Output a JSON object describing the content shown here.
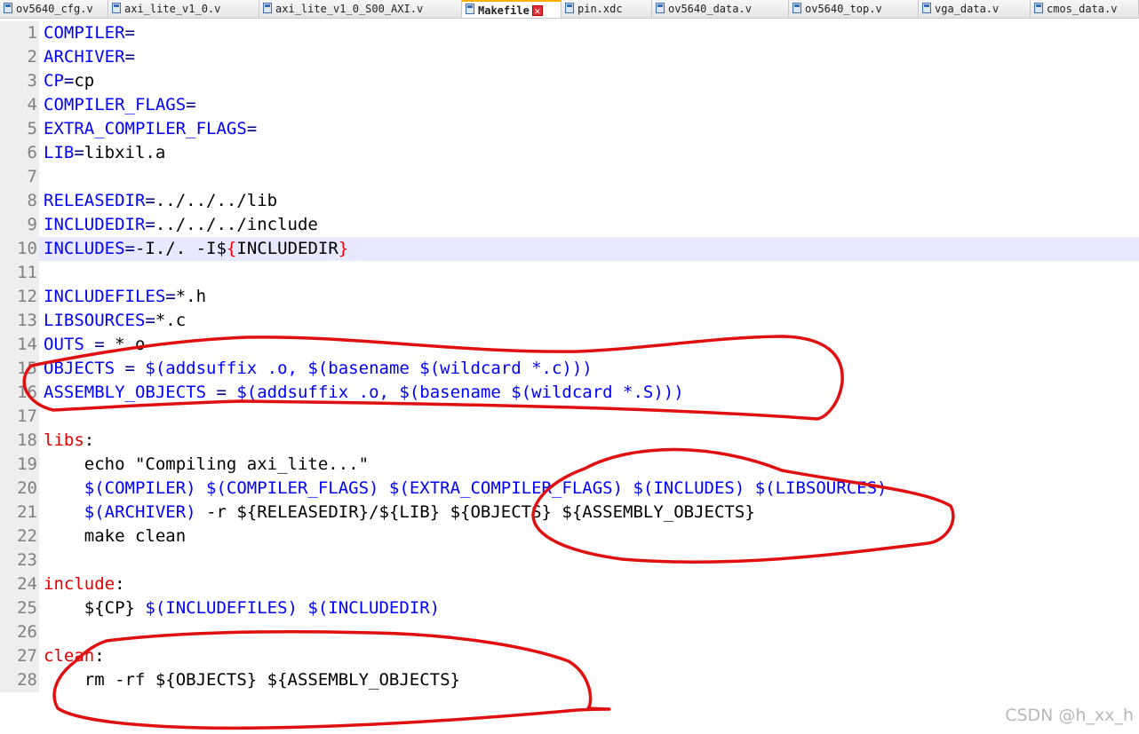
{
  "tabs": [
    {
      "label": "ov5640_cfg.v"
    },
    {
      "label": "axi_lite_v1_0.v"
    },
    {
      "label": "axi_lite_v1_0_S00_AXI.v"
    },
    {
      "label": "Makefile"
    },
    {
      "label": "pin.xdc"
    },
    {
      "label": "ov5640_data.v"
    },
    {
      "label": "ov5640_top.v"
    },
    {
      "label": "vga_data.v"
    },
    {
      "label": "cmos_data.v"
    }
  ],
  "editor": {
    "line_numbers": [
      "1",
      "2",
      "3",
      "4",
      "5",
      "6",
      "7",
      "8",
      "9",
      "10",
      "11",
      "12",
      "13",
      "14",
      "15",
      "16",
      "17",
      "18",
      "19",
      "20",
      "21",
      "22",
      "23",
      "24",
      "25",
      "26",
      "27",
      "28"
    ],
    "lines": [
      [
        {
          "c": "v",
          "t": "COMPILER"
        },
        {
          "c": "op",
          "t": "="
        }
      ],
      [
        {
          "c": "v",
          "t": "ARCHIVER"
        },
        {
          "c": "op",
          "t": "="
        }
      ],
      [
        {
          "c": "v",
          "t": "CP"
        },
        {
          "c": "op",
          "t": "="
        },
        {
          "c": "",
          "t": "cp"
        }
      ],
      [
        {
          "c": "v",
          "t": "COMPILER_FLAGS"
        },
        {
          "c": "op",
          "t": "="
        }
      ],
      [
        {
          "c": "v",
          "t": "EXTRA_COMPILER_FLAGS"
        },
        {
          "c": "op",
          "t": "="
        }
      ],
      [
        {
          "c": "v",
          "t": "LIB"
        },
        {
          "c": "op",
          "t": "="
        },
        {
          "c": "",
          "t": "libxil.a"
        }
      ],
      [],
      [
        {
          "c": "v",
          "t": "RELEASEDIR"
        },
        {
          "c": "op",
          "t": "="
        },
        {
          "c": "",
          "t": "../../../lib"
        }
      ],
      [
        {
          "c": "v",
          "t": "INCLUDEDIR"
        },
        {
          "c": "op",
          "t": "="
        },
        {
          "c": "",
          "t": "../../../include"
        }
      ],
      [
        {
          "c": "v",
          "t": "INCLUDES"
        },
        {
          "c": "op",
          "t": "="
        },
        {
          "c": "",
          "t": "-I./. -I$"
        },
        {
          "c": "br",
          "t": "{"
        },
        {
          "c": "hl",
          "t": "INCLUDEDIR"
        },
        {
          "c": "br",
          "t": "}"
        }
      ],
      [],
      [
        {
          "c": "v",
          "t": "INCLUDEFILES"
        },
        {
          "c": "op",
          "t": "="
        },
        {
          "c": "",
          "t": "*.h"
        }
      ],
      [
        {
          "c": "v",
          "t": "LIBSOURCES"
        },
        {
          "c": "op",
          "t": "="
        },
        {
          "c": "",
          "t": "*.c"
        }
      ],
      [
        {
          "c": "v",
          "t": "OUTS"
        },
        {
          "c": "op",
          "t": " = "
        },
        {
          "c": "",
          "t": "*.o"
        }
      ],
      [
        {
          "c": "v",
          "t": "OBJECTS"
        },
        {
          "c": "op",
          "t": " = "
        },
        {
          "c": "v",
          "t": "$(addsuffix .o, $(basename $(wildcard *.c)))"
        }
      ],
      [
        {
          "c": "v",
          "t": "ASSEMBLY_OBJECTS"
        },
        {
          "c": "op",
          "t": " = "
        },
        {
          "c": "v",
          "t": "$(addsuffix .o, $(basename $(wildcard *.S)))"
        }
      ],
      [],
      [
        {
          "c": "t",
          "t": "libs"
        },
        {
          "c": "",
          "t": ":"
        }
      ],
      [
        {
          "c": "",
          "t": "    echo \"Compiling axi_lite...\""
        }
      ],
      [
        {
          "c": "",
          "t": "    "
        },
        {
          "c": "v",
          "t": "$(COMPILER) $(COMPILER_FLAGS) $(EXTRA_COMPILER_FLAGS) $(INCLUDES) $(LIBSOURCES)"
        }
      ],
      [
        {
          "c": "",
          "t": "    "
        },
        {
          "c": "v",
          "t": "$(ARCHIVER)"
        },
        {
          "c": "",
          "t": " -r ${RELEASEDIR}/${LIB} ${OBJECTS} ${ASSEMBLY_OBJECTS}"
        }
      ],
      [
        {
          "c": "",
          "t": "    make clean"
        }
      ],
      [],
      [
        {
          "c": "t",
          "t": "include"
        },
        {
          "c": "",
          "t": ":"
        }
      ],
      [
        {
          "c": "",
          "t": "    ${CP} "
        },
        {
          "c": "v",
          "t": "$(INCLUDEFILES) $(INCLUDEDIR)"
        }
      ],
      [],
      [
        {
          "c": "t",
          "t": "clean"
        },
        {
          "c": "",
          "t": ":"
        }
      ],
      [
        {
          "c": "",
          "t": "    rm -rf ${OBJECTS} ${ASSEMBLY_OBJECTS}"
        }
      ]
    ]
  },
  "watermark": "CSDN @h_xx_h",
  "colors": {
    "variable": "#0000ff",
    "target": "#e00000",
    "annotation": "#e01010",
    "current_line": "#e8e8ff",
    "active_tab_accent": "#ffb000"
  }
}
